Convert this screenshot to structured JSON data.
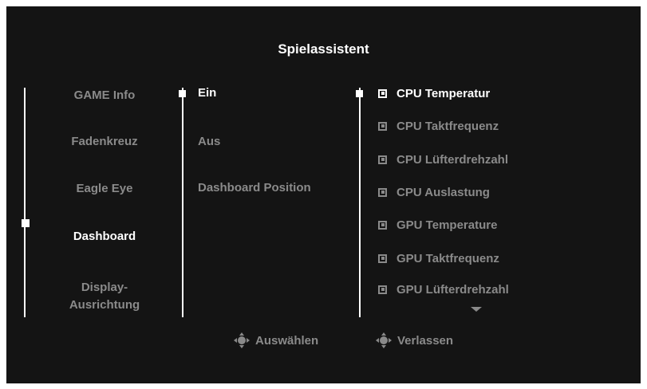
{
  "menu": {
    "title": "Spielassistent"
  },
  "col1": {
    "items": [
      "GAME Info",
      "Fadenkreuz",
      "Eagle Eye",
      "Dashboard",
      "Display-",
      "Ausrichtung"
    ]
  },
  "col2": {
    "items": [
      "Ein",
      "Aus",
      "Dashboard Position"
    ]
  },
  "col3": {
    "items": [
      "CPU Temperatur",
      "CPU Taktfrequenz",
      "CPU Lüfterdrehzahl",
      "CPU Auslastung",
      "GPU Temperature",
      "GPU Taktfrequenz",
      "GPU Lüfterdrehzahl"
    ]
  },
  "footer": {
    "select_label": "Auswählen",
    "exit_label": "Verlassen"
  },
  "colors": {
    "background": "#141414",
    "active_text": "#ffffff",
    "inactive_text": "#8a8a8a"
  },
  "icons": [
    "joystick-icon",
    "joystick-icon"
  ]
}
